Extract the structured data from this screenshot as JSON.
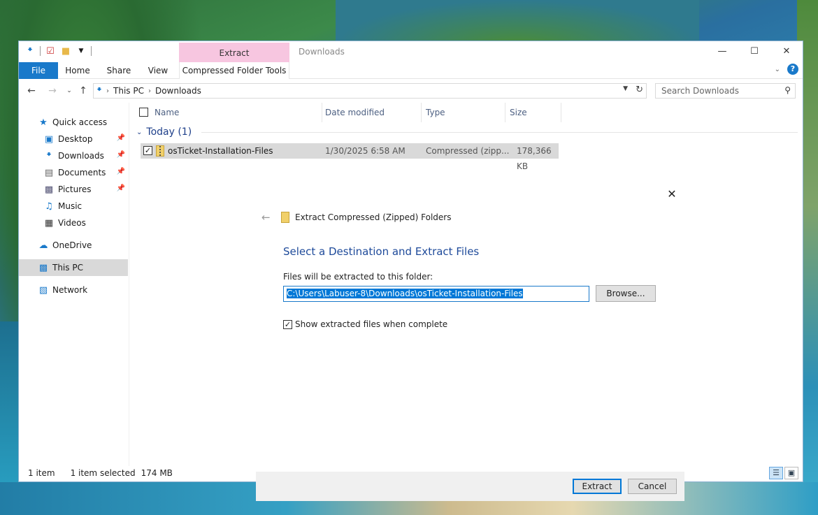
{
  "window": {
    "title": "Downloads",
    "context_tab": "Extract",
    "tabs": [
      "File",
      "Home",
      "Share",
      "View",
      "Compressed Folder Tools"
    ]
  },
  "address": {
    "crumbs": [
      "This PC",
      "Downloads"
    ],
    "search_placeholder": "Search Downloads"
  },
  "sidebar": {
    "items": [
      {
        "label": "Quick access",
        "icon": "star-icon"
      },
      {
        "label": "Desktop",
        "icon": "desktop-icon"
      },
      {
        "label": "Downloads",
        "icon": "download-icon"
      },
      {
        "label": "Documents",
        "icon": "document-icon"
      },
      {
        "label": "Pictures",
        "icon": "picture-icon"
      },
      {
        "label": "Music",
        "icon": "music-icon"
      },
      {
        "label": "Videos",
        "icon": "video-icon"
      },
      {
        "label": "OneDrive",
        "icon": "cloud-icon"
      },
      {
        "label": "This PC",
        "icon": "computer-icon"
      },
      {
        "label": "Network",
        "icon": "network-icon"
      }
    ]
  },
  "columns": {
    "name": "Name",
    "date": "Date modified",
    "type": "Type",
    "size": "Size"
  },
  "group": {
    "label": "Today (1)"
  },
  "files": [
    {
      "name": "osTicket-Installation-Files",
      "date": "1/30/2025 6:58 AM",
      "type": "Compressed (zipp...",
      "size": "178,366 KB"
    }
  ],
  "status": {
    "count": "1 item",
    "selected": "1 item selected",
    "size": "174 MB"
  },
  "dialog": {
    "title": "Extract Compressed (Zipped) Folders",
    "heading": "Select a Destination and Extract Files",
    "label": "Files will be extracted to this folder:",
    "path": "C:\\Users\\Labuser-8\\Downloads\\osTicket-Installation-Files",
    "browse": "Browse...",
    "checkbox_label": "Show extracted files when complete",
    "extract": "Extract",
    "cancel": "Cancel"
  },
  "colors": {
    "accent": "#1979ca",
    "context_tab": "#f7c6e0",
    "heading": "#1e4a9a"
  }
}
